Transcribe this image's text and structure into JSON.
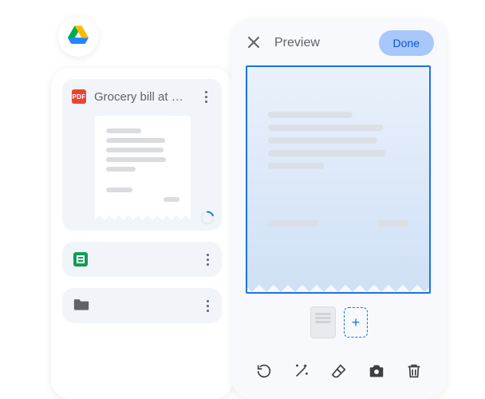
{
  "drive": {
    "logo_name": "google-drive-icon"
  },
  "files": {
    "primary": {
      "badge_text": "PDF",
      "title": "Grocery bill at Bi…",
      "loading": true
    },
    "rows": [
      {
        "icon": "sheets-icon",
        "type": "spreadsheet"
      },
      {
        "icon": "folder-icon",
        "type": "folder"
      }
    ]
  },
  "preview": {
    "title": "Preview",
    "done_label": "Done",
    "add_page_glyph": "+",
    "toolbar": [
      {
        "name": "retake-icon"
      },
      {
        "name": "magic-icon"
      },
      {
        "name": "erase-icon"
      },
      {
        "name": "camera-icon"
      },
      {
        "name": "delete-icon"
      }
    ]
  }
}
